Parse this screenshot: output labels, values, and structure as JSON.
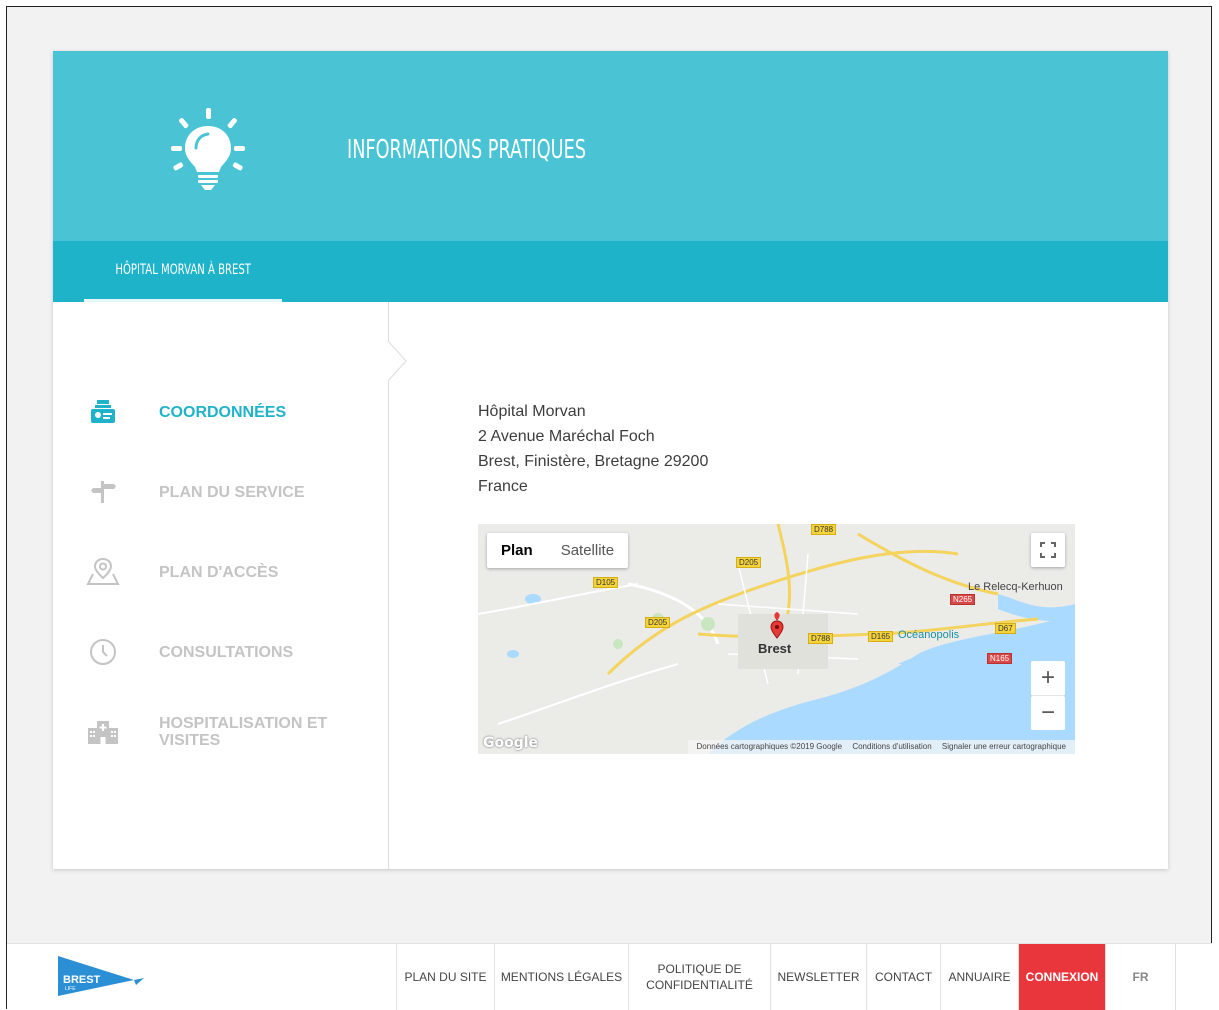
{
  "hero": {
    "title": "INFORMATIONS PRATIQUES",
    "icon": "lightbulb-icon"
  },
  "tabs": [
    {
      "label": "HÔPITAL MORVAN À BREST",
      "active": true
    }
  ],
  "colors": {
    "hero": "#4ac4d5",
    "tabbar": "#1fb3c9",
    "accent": "#1fb3c9",
    "connexion": "#e8363c"
  },
  "nav": [
    {
      "label": "COORDONNÉES",
      "icon": "contact-card-icon",
      "active": true
    },
    {
      "label": "PLAN DU SERVICE",
      "icon": "signpost-icon",
      "active": false
    },
    {
      "label": "PLAN D'ACCÈS",
      "icon": "map-pin-icon",
      "active": false
    },
    {
      "label": "CONSULTATIONS",
      "icon": "clock-icon",
      "active": false
    },
    {
      "label": "HOSPITALISATION ET VISITES",
      "icon": "hospital-icon",
      "active": false
    }
  ],
  "address": {
    "line1": "Hôpital  Morvan",
    "line2": "2 Avenue Maréchal Foch",
    "line3": "Brest, Finistère, Bretagne 29200",
    "line4": "France"
  },
  "map": {
    "type_plan": "Plan",
    "type_satellite": "Satellite",
    "zoom_in": "+",
    "zoom_out": "−",
    "google": "Google",
    "attribution": [
      "Données cartographiques ©2019 Google",
      "Conditions d'utilisation",
      "Signaler une erreur cartographique"
    ],
    "labels": {
      "city": "Brest",
      "relecq": "Le Relecq-Kerhuon",
      "oceanopolis": "Océanopolis"
    },
    "roads": [
      "D788",
      "D205",
      "D105",
      "D205",
      "D788",
      "D165",
      "D67",
      "N265",
      "N165"
    ]
  },
  "footer": {
    "logo_text": "BREST",
    "logo_sub": "LIFE",
    "links": [
      "PLAN DU SITE",
      "MENTIONS LÉGALES",
      "POLITIQUE DE CONFIDENTIALITÉ",
      "NEWSLETTER",
      "CONTACT",
      "ANNUAIRE"
    ],
    "connexion": "CONNEXION",
    "lang": "FR"
  }
}
